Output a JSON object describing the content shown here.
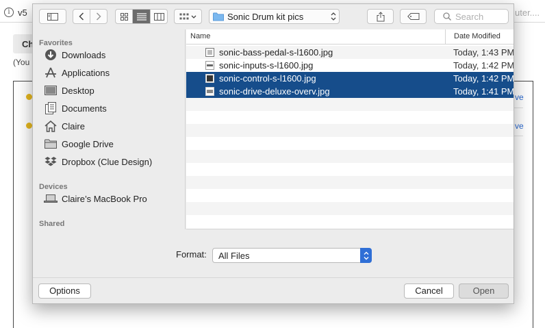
{
  "background_page": {
    "url_left": "v5",
    "url_right": "uter....",
    "button_label": "Ch",
    "paren_text": "(You",
    "rows": [
      {
        "link_text": "ve"
      },
      {
        "link_text": "ve"
      }
    ]
  },
  "dialog": {
    "location": {
      "label": "Sonic Drum kit pics",
      "icon": "folder-icon"
    },
    "search": {
      "placeholder": "Search",
      "value": ""
    },
    "sidebar": {
      "favorites_header": "Favorites",
      "favorites": [
        {
          "label": "Downloads",
          "icon": "downloads-icon"
        },
        {
          "label": "Applications",
          "icon": "applications-icon"
        },
        {
          "label": "Desktop",
          "icon": "desktop-icon"
        },
        {
          "label": "Documents",
          "icon": "documents-icon"
        },
        {
          "label": "Claire",
          "icon": "home-icon"
        },
        {
          "label": "Google Drive",
          "icon": "folder-icon"
        },
        {
          "label": "Dropbox (Clue Design)",
          "icon": "dropbox-icon"
        }
      ],
      "devices_header": "Devices",
      "devices": [
        {
          "label": "Claire’s MacBook Pro",
          "icon": "laptop-icon"
        }
      ],
      "shared_header": "Shared"
    },
    "columns": {
      "name": "Name",
      "date_modified": "Date Modified"
    },
    "files": [
      {
        "name": "sonic-bass-pedal-s-l1600.jpg",
        "date": "Today, 1:43 PM",
        "selected": false
      },
      {
        "name": "sonic-inputs-s-l1600.jpg",
        "date": "Today, 1:42 PM",
        "selected": false
      },
      {
        "name": "sonic-control-s-l1600.jpg",
        "date": "Today, 1:42 PM",
        "selected": true
      },
      {
        "name": "sonic-drive-deluxe-overv.jpg",
        "date": "Today, 1:41 PM",
        "selected": true
      }
    ],
    "format": {
      "label": "Format:",
      "value": "All Files"
    },
    "buttons": {
      "options": "Options",
      "cancel": "Cancel",
      "open": "Open"
    },
    "colors": {
      "selection": "#164d8b",
      "accent": "#2f6fd6"
    }
  }
}
